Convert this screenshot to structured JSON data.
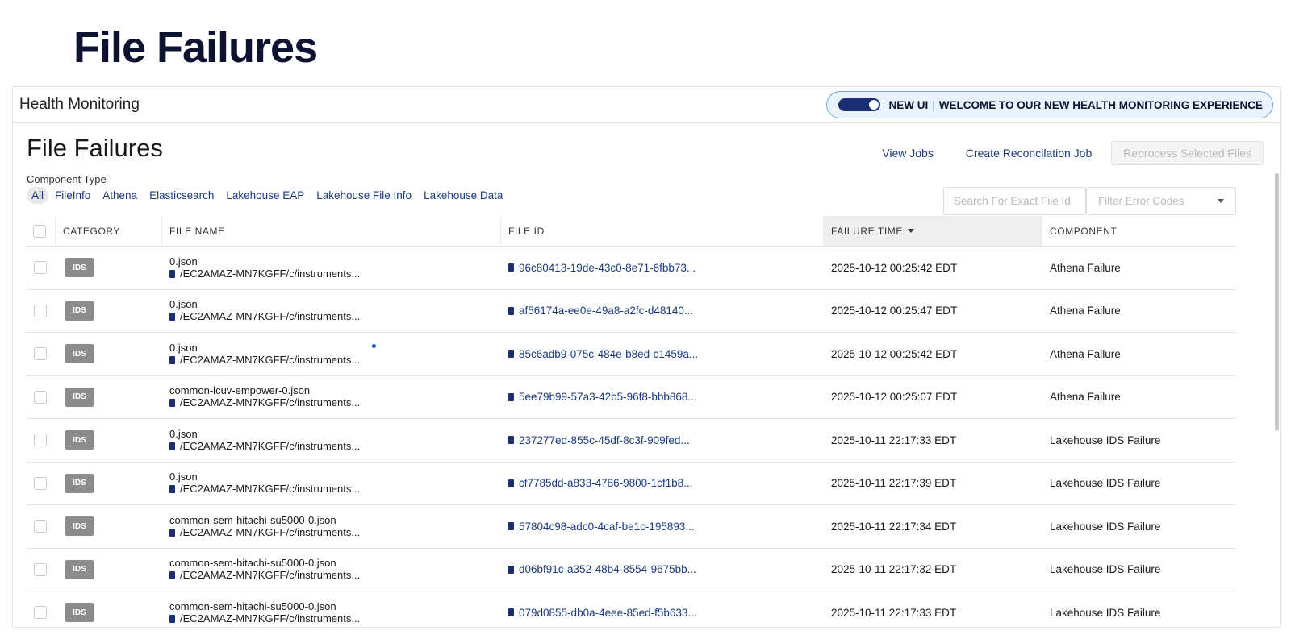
{
  "slide_title": "File Failures",
  "app_header": {
    "name": "Health Monitoring",
    "new_ui_label": "NEW UI",
    "separator": "|",
    "welcome_text": "WELCOME TO OUR NEW HEALTH MONITORING EXPERIENCE"
  },
  "page": {
    "title": "File Failures",
    "actions": {
      "view_jobs": "View Jobs",
      "create_reconciliation": "Create Reconcilation Job",
      "reprocess": "Reprocess Selected Files"
    },
    "component_type_label": "Component Type",
    "filters": [
      {
        "label": "All",
        "active": true
      },
      {
        "label": "FileInfo",
        "active": false
      },
      {
        "label": "Athena",
        "active": false
      },
      {
        "label": "Elasticsearch",
        "active": false
      },
      {
        "label": "Lakehouse EAP",
        "active": false
      },
      {
        "label": "Lakehouse File Info",
        "active": false
      },
      {
        "label": "Lakehouse Data",
        "active": false
      }
    ],
    "search_placeholder": "Search For Exact File Id",
    "error_codes_placeholder": "Filter Error Codes"
  },
  "table": {
    "headers": {
      "category": "CATEGORY",
      "file_name": "FILE NAME",
      "file_id": "FILE ID",
      "failure_time": "FAILURE TIME",
      "component": "COMPONENT"
    },
    "rows": [
      {
        "category": "IDS",
        "file_name": "0.json",
        "path": "/EC2AMAZ-MN7KGFF/c/instruments...",
        "file_id": "96c80413-19de-43c0-8e71-6fbb73...",
        "failure_time": "2025-10-12 00:25:42 EDT",
        "component": "Athena Failure"
      },
      {
        "category": "IDS",
        "file_name": "0.json",
        "path": "/EC2AMAZ-MN7KGFF/c/instruments...",
        "file_id": "af56174a-ee0e-49a8-a2fc-d48140...",
        "failure_time": "2025-10-12 00:25:47 EDT",
        "component": "Athena Failure"
      },
      {
        "category": "IDS",
        "file_name": "0.json",
        "path": "/EC2AMAZ-MN7KGFF/c/instruments...",
        "file_id": "85c6adb9-075c-484e-b8ed-c1459a...",
        "failure_time": "2025-10-12 00:25:42 EDT",
        "component": "Athena Failure"
      },
      {
        "category": "IDS",
        "file_name": "common-lcuv-empower-0.json",
        "path": "/EC2AMAZ-MN7KGFF/c/instruments...",
        "file_id": "5ee79b99-57a3-42b5-96f8-bbb868...",
        "failure_time": "2025-10-12 00:25:07 EDT",
        "component": "Athena Failure"
      },
      {
        "category": "IDS",
        "file_name": "0.json",
        "path": "/EC2AMAZ-MN7KGFF/c/instruments...",
        "file_id": "237277ed-855c-45df-8c3f-909fed...",
        "failure_time": "2025-10-11 22:17:33 EDT",
        "component": "Lakehouse IDS Failure"
      },
      {
        "category": "IDS",
        "file_name": "0.json",
        "path": "/EC2AMAZ-MN7KGFF/c/instruments...",
        "file_id": "cf7785dd-a833-4786-9800-1cf1b8...",
        "failure_time": "2025-10-11 22:17:39 EDT",
        "component": "Lakehouse IDS Failure"
      },
      {
        "category": "IDS",
        "file_name": "common-sem-hitachi-su5000-0.json",
        "path": "/EC2AMAZ-MN7KGFF/c/instruments...",
        "file_id": "57804c98-adc0-4caf-be1c-195893...",
        "failure_time": "2025-10-11 22:17:34 EDT",
        "component": "Lakehouse IDS Failure"
      },
      {
        "category": "IDS",
        "file_name": "common-sem-hitachi-su5000-0.json",
        "path": "/EC2AMAZ-MN7KGFF/c/instruments...",
        "file_id": "d06bf91c-a352-48b4-8554-9675bb...",
        "failure_time": "2025-10-11 22:17:32 EDT",
        "component": "Lakehouse IDS Failure"
      },
      {
        "category": "IDS",
        "file_name": "common-sem-hitachi-su5000-0.json",
        "path": "/EC2AMAZ-MN7KGFF/c/instruments...",
        "file_id": "079d0855-db0a-4eee-85ed-f5b633...",
        "failure_time": "2025-10-11 22:17:33 EDT",
        "component": "Lakehouse IDS Failure"
      }
    ]
  },
  "colors": {
    "brand_navy": "#1a2f73",
    "link_blue": "#1a3a80",
    "badge_gray": "#8c8c8c",
    "pill_border": "#6fa8dc"
  }
}
